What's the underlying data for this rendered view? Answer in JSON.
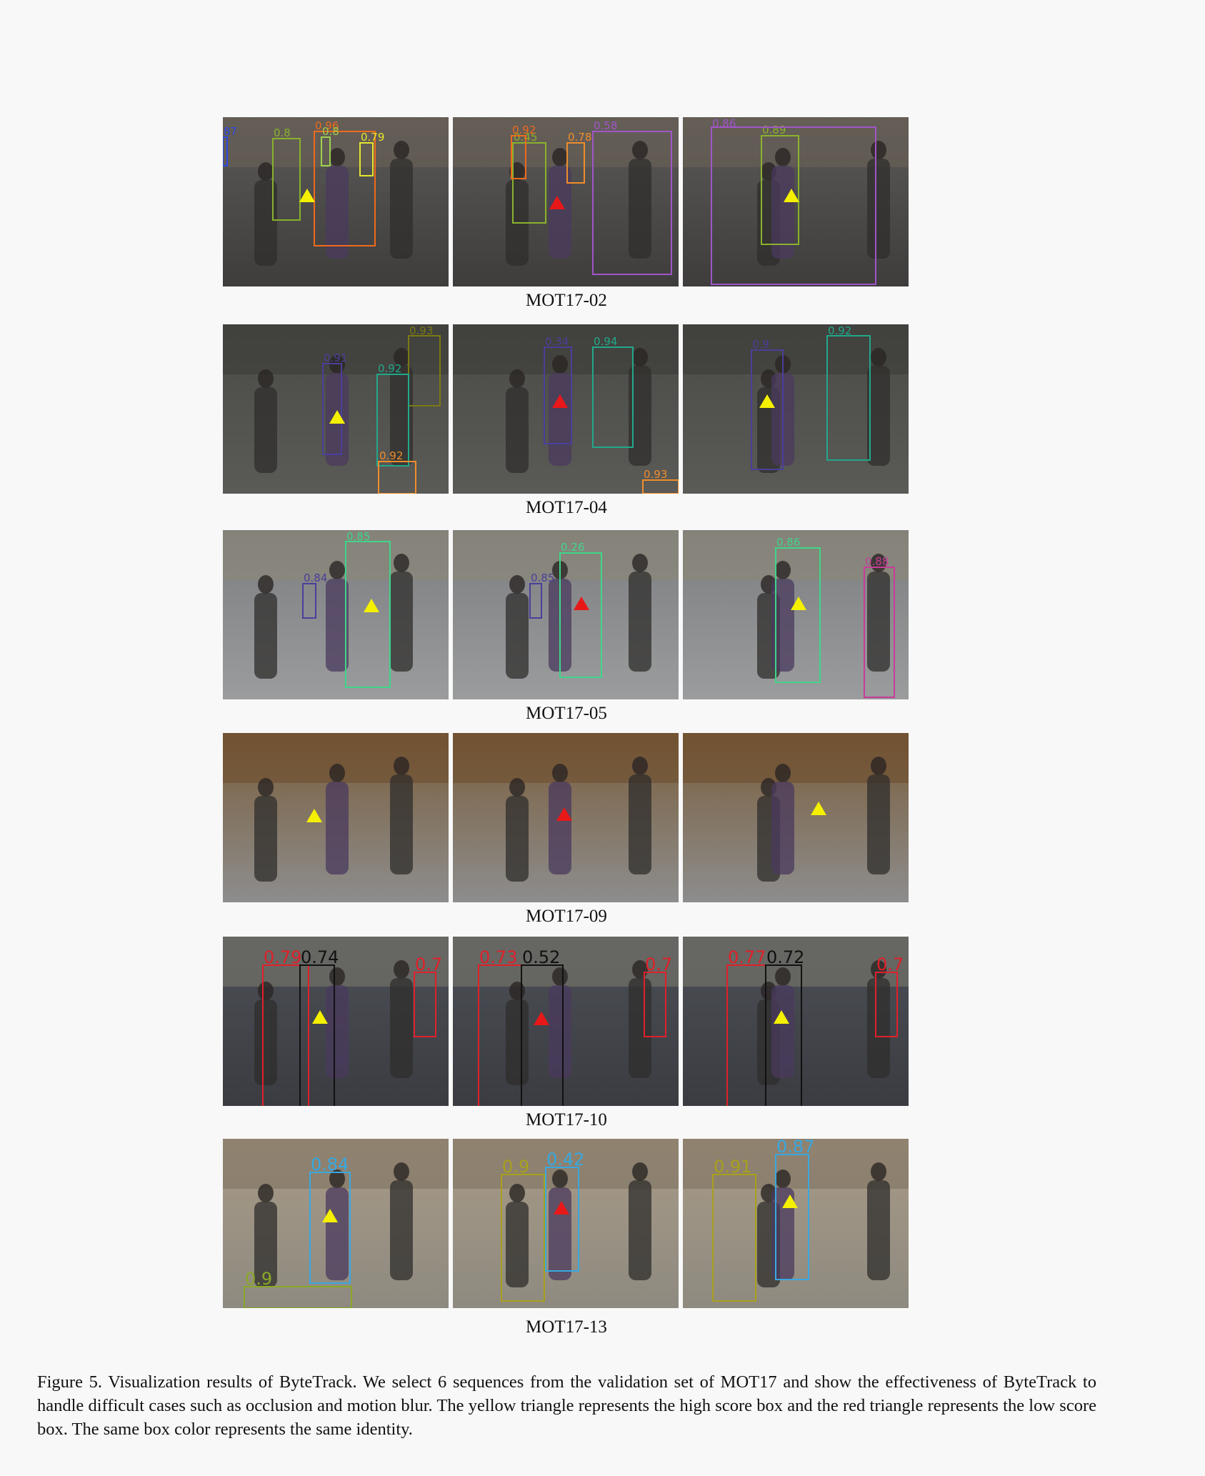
{
  "rows": [
    {
      "label": "MOT17-02",
      "frames": [
        {
          "boxes": [
            {
              "s": "0.8",
              "c": "#8ab22c"
            },
            {
              "s": "0.96",
              "c": "#ef6a1c"
            },
            {
              "s": "0.79",
              "c": "#e6e62b"
            },
            {
              "s": "87",
              "c": "#3048e0"
            },
            {
              "s": "0.8",
              "c": "#9dd14d"
            }
          ],
          "tri": "high"
        },
        {
          "boxes": [
            {
              "s": "0.45",
              "c": "#8ab22c"
            },
            {
              "s": "0.78",
              "c": "#ef8d2c"
            },
            {
              "s": "0.58",
              "c": "#a055c8"
            },
            {
              "s": "0.92",
              "c": "#ef6a1c"
            }
          ],
          "tri": "low"
        },
        {
          "boxes": [
            {
              "s": "0.89",
              "c": "#8ab22c"
            },
            {
              "s": "0.86",
              "c": "#a055c8"
            }
          ],
          "tri": "high"
        }
      ]
    },
    {
      "label": "MOT17-04",
      "frames": [
        {
          "boxes": [
            {
              "s": "0.91",
              "c": "#4a3f9a"
            },
            {
              "s": "0.93",
              "c": "#7a7a14"
            },
            {
              "s": "0.92",
              "c": "#22a88a"
            },
            {
              "s": "0.92",
              "c": "#ef8d2c"
            }
          ],
          "tri": "high"
        },
        {
          "boxes": [
            {
              "s": "0.34",
              "c": "#4a3f9a"
            },
            {
              "s": "0.94",
              "c": "#22a88a"
            },
            {
              "s": "0.93",
              "c": "#ef8d2c"
            }
          ],
          "tri": "low"
        },
        {
          "boxes": [
            {
              "s": "0.9",
              "c": "#4a3f9a"
            },
            {
              "s": "0.92",
              "c": "#22a88a"
            }
          ],
          "tri": "high"
        }
      ]
    },
    {
      "label": "MOT17-05",
      "frames": [
        {
          "boxes": [
            {
              "s": "0.85",
              "c": "#3fd68a"
            },
            {
              "s": "0.84",
              "c": "#4a3f9a"
            }
          ],
          "tri": "high"
        },
        {
          "boxes": [
            {
              "s": "0.26",
              "c": "#3fd68a"
            },
            {
              "s": "0.85",
              "c": "#4a3f9a"
            }
          ],
          "tri": "low"
        },
        {
          "boxes": [
            {
              "s": "0.86",
              "c": "#3fd68a"
            },
            {
              "s": "0.88",
              "c": "#c83b9a"
            }
          ],
          "tri": "high"
        }
      ]
    },
    {
      "label": "MOT17-09",
      "frames": [
        {
          "boxes": [],
          "tri": "high"
        },
        {
          "boxes": [],
          "tri": "low"
        },
        {
          "boxes": [],
          "tri": "high"
        }
      ]
    },
    {
      "label": "MOT17-10",
      "frames": [
        {
          "boxes": [
            {
              "s": "0.79",
              "c": "#e0202a"
            },
            {
              "s": "0.74",
              "c": "#111111"
            },
            {
              "s": "0.7",
              "c": "#e0202a"
            }
          ],
          "tri": "high"
        },
        {
          "boxes": [
            {
              "s": "0.73",
              "c": "#e0202a"
            },
            {
              "s": "0.52",
              "c": "#111111"
            },
            {
              "s": "0.7",
              "c": "#e0202a"
            }
          ],
          "tri": "low"
        },
        {
          "boxes": [
            {
              "s": "0.77",
              "c": "#e0202a"
            },
            {
              "s": "0.72",
              "c": "#111111"
            },
            {
              "s": "0.7",
              "c": "#e0202a"
            }
          ],
          "tri": "high"
        }
      ]
    },
    {
      "label": "MOT17-13",
      "frames": [
        {
          "boxes": [
            {
              "s": "0.84",
              "c": "#38a8e0"
            },
            {
              "s": "0.9",
              "c": "#8aa828"
            }
          ],
          "tri": "high"
        },
        {
          "boxes": [
            {
              "s": "0.42",
              "c": "#38a8e0"
            },
            {
              "s": "0.9",
              "c": "#a8a01c"
            }
          ],
          "tri": "low"
        },
        {
          "boxes": [
            {
              "s": "0.87",
              "c": "#38a8e0"
            },
            {
              "s": "0.91",
              "c": "#a8a01c"
            }
          ],
          "tri": "high"
        }
      ]
    }
  ],
  "triangle_colors": {
    "high": "#f5f000",
    "low": "#e81818"
  },
  "caption": "Figure 5.  Visualization results of ByteTrack.  We select 6 sequences from the validation set of MOT17 and show the effectiveness of ByteTrack to handle difficult cases such as occlusion and motion blur.  The yellow triangle represents the high score box and the red triangle represents the low score box. The same box color represents the same identity."
}
